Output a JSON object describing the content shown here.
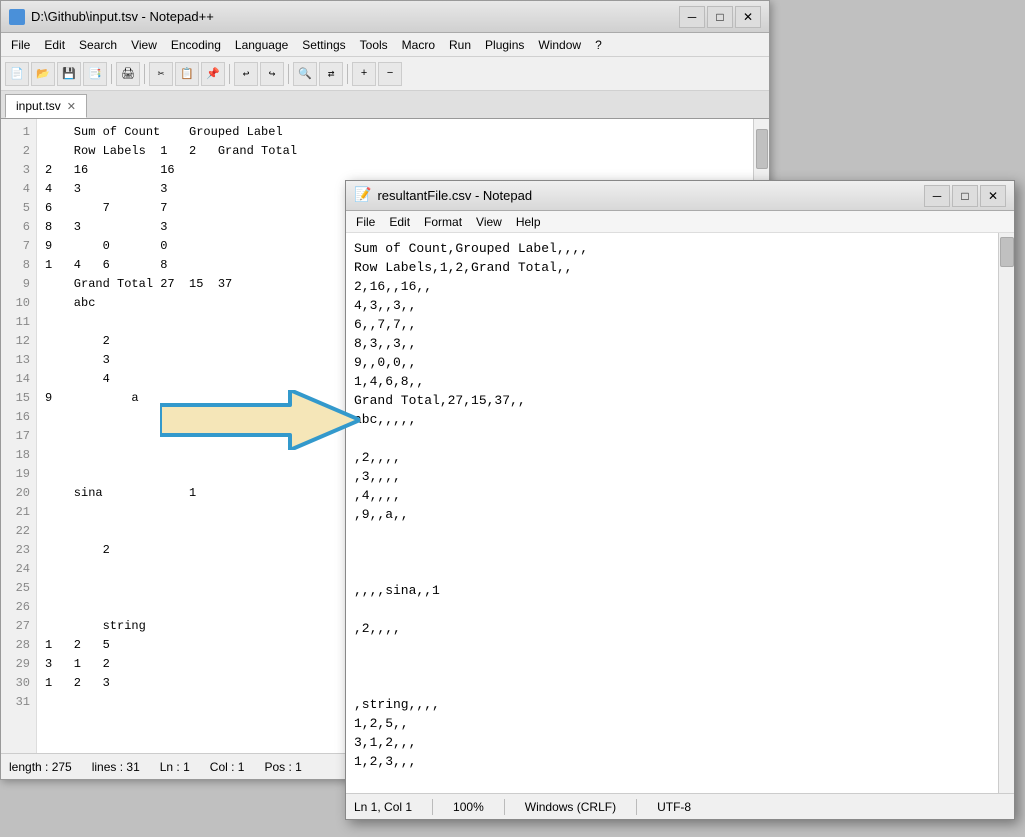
{
  "npp": {
    "title": "D:\\Github\\input.tsv - Notepad++",
    "tab_name": "input.tsv",
    "menu": [
      "File",
      "Edit",
      "Search",
      "View",
      "Encoding",
      "Language",
      "Settings",
      "Tools",
      "Macro",
      "Run",
      "Plugins",
      "Window",
      "?"
    ],
    "status": {
      "length": "length : 275",
      "lines": "lines : 31",
      "ln": "Ln : 1",
      "col": "Col : 1",
      "pos": "Pos : 1"
    },
    "lines": [
      {
        "num": "1",
        "text": "    Sum of Count    Grouped Label"
      },
      {
        "num": "2",
        "text": "    Row Labels  1   2   Grand Total"
      },
      {
        "num": "3",
        "text": "2   16          16"
      },
      {
        "num": "4",
        "text": "4   3           3"
      },
      {
        "num": "5",
        "text": "6       7       7"
      },
      {
        "num": "6",
        "text": "8   3           3"
      },
      {
        "num": "7",
        "text": "9       0       0"
      },
      {
        "num": "8",
        "text": "1   4   6       8"
      },
      {
        "num": "9",
        "text": "    Grand Total 27  15  37"
      },
      {
        "num": "10",
        "text": "    abc"
      },
      {
        "num": "11",
        "text": ""
      },
      {
        "num": "12",
        "text": "        2"
      },
      {
        "num": "13",
        "text": "        3"
      },
      {
        "num": "14",
        "text": "        4"
      },
      {
        "num": "15",
        "text": "9           a"
      },
      {
        "num": "16",
        "text": ""
      },
      {
        "num": "17",
        "text": ""
      },
      {
        "num": "18",
        "text": ""
      },
      {
        "num": "19",
        "text": ""
      },
      {
        "num": "20",
        "text": "    sina            1"
      },
      {
        "num": "21",
        "text": ""
      },
      {
        "num": "22",
        "text": ""
      },
      {
        "num": "23",
        "text": "        2"
      },
      {
        "num": "24",
        "text": ""
      },
      {
        "num": "25",
        "text": ""
      },
      {
        "num": "26",
        "text": ""
      },
      {
        "num": "27",
        "text": "        string"
      },
      {
        "num": "28",
        "text": "1   2   5"
      },
      {
        "num": "29",
        "text": "3   1   2"
      },
      {
        "num": "30",
        "text": "1   2   3"
      },
      {
        "num": "31",
        "text": ""
      }
    ]
  },
  "np": {
    "title": "resultantFile.csv - Notepad",
    "menu": [
      "File",
      "Edit",
      "Format",
      "View",
      "Help"
    ],
    "status": {
      "ln_col": "Ln 1, Col 1",
      "zoom": "100%",
      "encoding": "UTF-8",
      "line_ending": "Windows (CRLF)"
    },
    "lines": [
      "Sum of Count,Grouped Label,,,,",
      "Row Labels,1,2,Grand Total,,",
      "2,16,,16,,",
      "4,3,,3,,",
      "6,,7,7,,",
      "8,3,,3,,",
      "9,,0,0,,",
      "1,4,6,8,,",
      "Grand Total,27,15,37,,",
      "abc,,,,,",
      "",
      ",2,,,,",
      ",3,,,,",
      ",4,,,,",
      ",9,,a,,",
      "",
      "",
      "",
      ",,,,sina,,1",
      "",
      ",2,,,,",
      "",
      "",
      "",
      ",string,,,,",
      "1,2,5,,",
      "3,1,2,,,",
      "1,2,3,,,"
    ]
  },
  "arrow": {
    "fill": "#f5e6b8",
    "stroke": "#3399cc",
    "stroke_width": "4"
  }
}
